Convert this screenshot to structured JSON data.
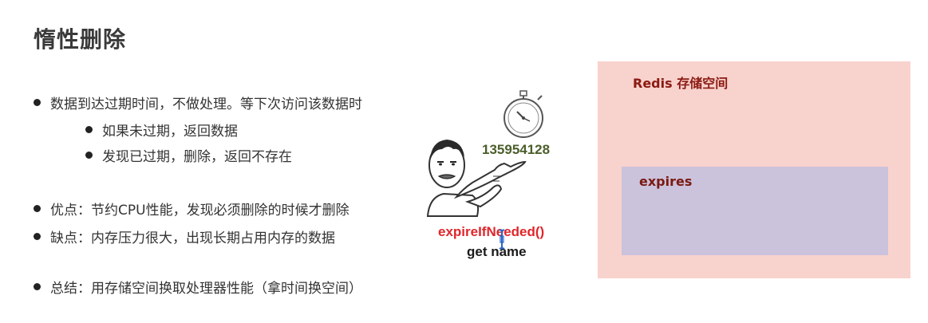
{
  "title": "惰性删除",
  "bullets": {
    "main": "数据到达过期时间，不做处理。等下次访问该数据时",
    "sub1": "如果未过期，返回数据",
    "sub2": "发现已过期，删除，返回不存在",
    "pro": "优点：节约CPU性能，发现必须删除的时候才删除",
    "con": "缺点：内存压力很大，出现长期占用内存的数据",
    "summary": "总结：用存储空间换取处理器性能（拿时间换空间）"
  },
  "illustration": {
    "counter": "135954128",
    "function": "expireIfNeeded()",
    "command": "get name",
    "icons": [
      "stopwatch-icon",
      "pointing-man-icon",
      "text-cursor-icon"
    ]
  },
  "redis": {
    "label": "Redis 存储空间",
    "expires_label": "expires"
  },
  "colors": {
    "redis_bg": "#f8d2cd",
    "expires_bg": "#cbc2dc",
    "function_text": "#e0262b",
    "counter_text": "#4b5e2a"
  }
}
